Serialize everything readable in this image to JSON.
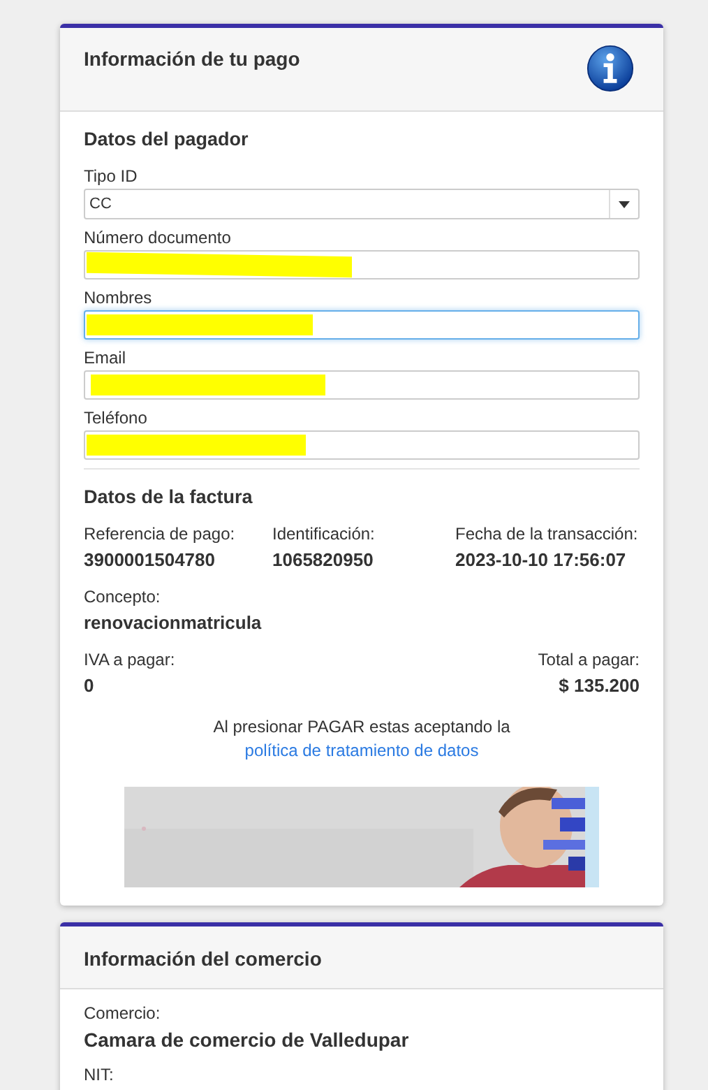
{
  "payment_card": {
    "title": "Información de tu pago",
    "payer": {
      "heading": "Datos del pagador",
      "fields": [
        {
          "label": "Tipo ID",
          "kind": "select",
          "value": "CC",
          "focused": false
        },
        {
          "label": "Número documento",
          "kind": "text",
          "focused": false,
          "redacted": true
        },
        {
          "label": "Nombres",
          "kind": "text",
          "focused": true,
          "redacted": true
        },
        {
          "label": "Email",
          "kind": "text",
          "focused": false,
          "redacted": true
        },
        {
          "label": "Teléfono",
          "kind": "text",
          "focused": false,
          "redacted": true
        }
      ]
    },
    "invoice": {
      "heading": "Datos de la factura",
      "rows": [
        [
          {
            "label": "Referencia de pago:",
            "value": "3900001504780"
          },
          {
            "label": "Identificación:",
            "value": "1065820950"
          },
          {
            "label": "Fecha de la transacción:",
            "value": "2023-10-10 17:56:07"
          }
        ],
        [
          {
            "label": "Concepto:",
            "value": "renovacionmatricula"
          }
        ]
      ],
      "iva": {
        "label": "IVA a pagar:",
        "value": "0"
      },
      "total": {
        "label": "Total a pagar:",
        "value": "$ 135.200"
      }
    },
    "terms": {
      "text": "Al presionar PAGAR estas aceptando la",
      "link": "política de tratamiento de datos"
    }
  },
  "merchant_card": {
    "title": "Información del comercio",
    "items": [
      {
        "label": "Comercio:",
        "value": "Camara de comercio de Valledupar"
      },
      {
        "label": "NIT:"
      }
    ]
  }
}
